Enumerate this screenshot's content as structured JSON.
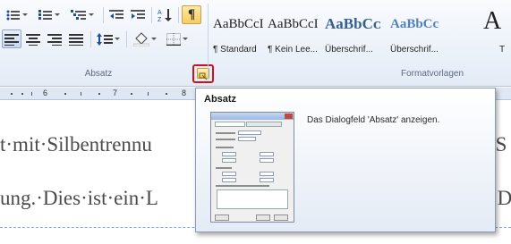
{
  "ribbon": {
    "paragraph_group_label": "Absatz",
    "styles_group_label": "Formatvorlagen",
    "paragraph_buttons": [
      {
        "name": "bullets-button",
        "icon": "bullet-list-icon",
        "dropdown": true
      },
      {
        "name": "numbering-button",
        "icon": "numbered-list-icon",
        "dropdown": true
      },
      {
        "name": "multilevel-list-button",
        "icon": "multilevel-list-icon",
        "dropdown": true
      },
      {
        "name": "decrease-indent-button",
        "icon": "decrease-indent-icon"
      },
      {
        "name": "increase-indent-button",
        "icon": "increase-indent-icon"
      },
      {
        "name": "sort-button",
        "icon": "sort-az-icon"
      },
      {
        "name": "show-formatting-marks-button",
        "icon": "pilcrow-icon",
        "glyph": "¶",
        "active": true
      },
      {
        "name": "align-left-button",
        "icon": "align-left-icon",
        "selected": true
      },
      {
        "name": "align-center-button",
        "icon": "align-center-icon"
      },
      {
        "name": "align-right-button",
        "icon": "align-right-icon"
      },
      {
        "name": "justify-button",
        "icon": "justify-icon"
      },
      {
        "name": "line-spacing-button",
        "icon": "line-spacing-icon",
        "dropdown": true
      },
      {
        "name": "shading-button",
        "icon": "paint-bucket-icon",
        "dropdown": true
      },
      {
        "name": "borders-button",
        "icon": "borders-icon",
        "dropdown": true
      }
    ],
    "styles": [
      {
        "sample": "AaBbCcI",
        "name": "¶ Standard",
        "color": "#1f1f1f",
        "bold": false
      },
      {
        "sample": "AaBbCcI",
        "name": "¶ Kein Lee...",
        "color": "#1f1f1f",
        "bold": false
      },
      {
        "sample": "AaBbCᴄ",
        "name": "Überschrif...",
        "color": "#365f91",
        "bold": true
      },
      {
        "sample": "AaBbCc",
        "name": "Überschrif...",
        "color": "#4f81bd",
        "bold": true
      },
      {
        "sample": "A",
        "name": "T",
        "color": "#1f1f1f",
        "bold": false
      }
    ]
  },
  "ruler": {
    "numbers": [
      "6",
      "7",
      "8"
    ]
  },
  "document": {
    "lines": [
      {
        "left": "t·mit·Silbentrennu",
        "right": "·S"
      },
      {
        "left": "ung.·Dies·ist·ein·L",
        "right": "·D"
      }
    ]
  },
  "tooltip": {
    "title": "Absatz",
    "description": "Das Dialogfeld 'Absatz' anzeigen."
  },
  "colors": {
    "ribbon_bg": "#e3ebf6",
    "highlight_box": "#d0101a",
    "active_button": "#f8cd5c",
    "document_text": "#4b4b4b",
    "heading1": "#365f91",
    "heading2": "#4f81bd"
  }
}
